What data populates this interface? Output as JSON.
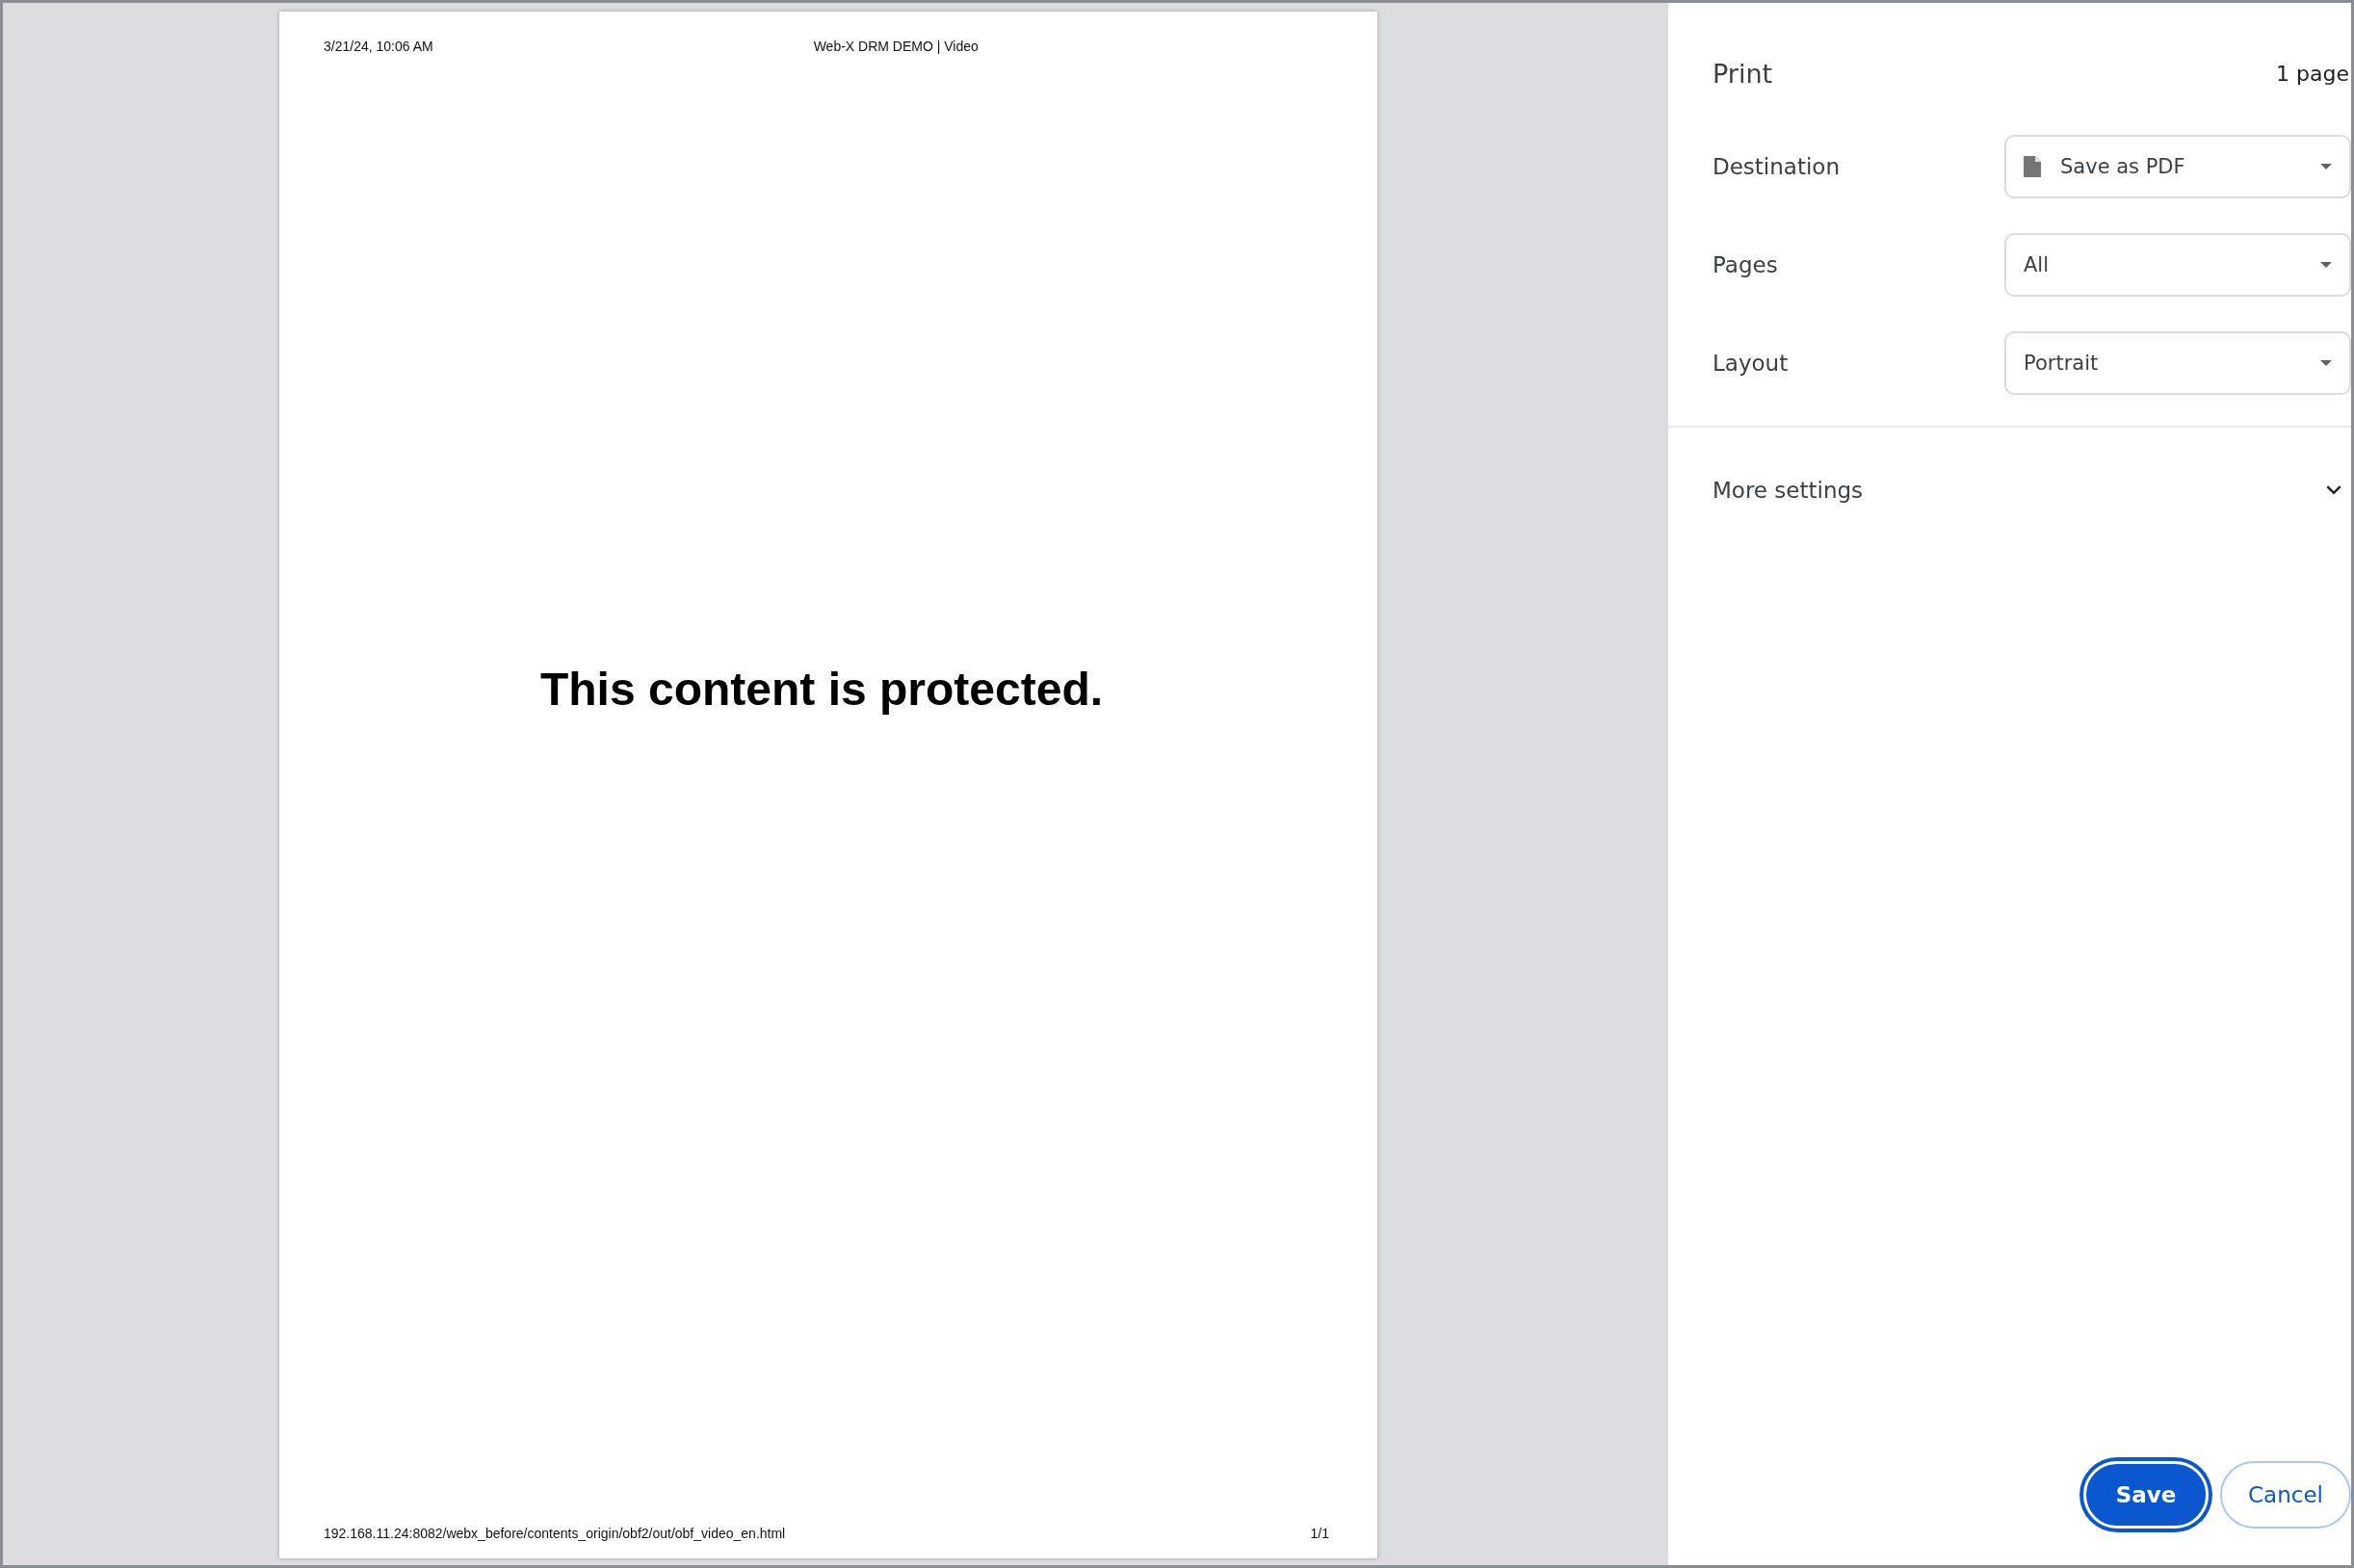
{
  "preview": {
    "header_left": "3/21/24, 10:06 AM",
    "header_center": "Web-X DRM DEMO | Video",
    "body": "This content is protected.",
    "footer_left": "192.168.11.24:8082/webx_before/contents_origin/obf2/out/obf_video_en.html",
    "footer_right": "1/1"
  },
  "panel": {
    "title": "Print",
    "page_count": "1 page",
    "settings": [
      {
        "label": "Destination",
        "value": "Save as PDF",
        "kind": "file-select"
      },
      {
        "label": "Pages",
        "value": "All",
        "kind": "select"
      },
      {
        "label": "Layout",
        "value": "Portrait",
        "kind": "select"
      }
    ],
    "more_settings": {
      "label": "More settings",
      "expanded": false
    },
    "buttons": [
      {
        "label": "Save",
        "kind": "primary"
      },
      {
        "label": "Cancel",
        "kind": "secondary"
      }
    ]
  }
}
